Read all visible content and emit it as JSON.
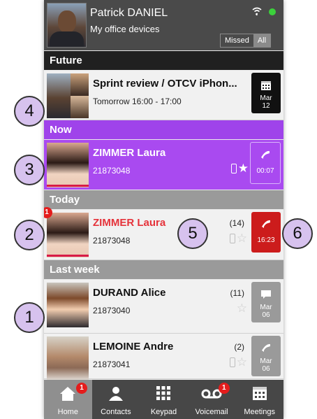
{
  "header": {
    "name": "Patrick DANIEL",
    "subtitle": "My office devices",
    "status_color": "#3bd13b",
    "filter": {
      "missed_label": "Missed",
      "all_label": "All",
      "selected": "All"
    }
  },
  "sections": {
    "future": "Future",
    "now": "Now",
    "today": "Today",
    "last_week": "Last week"
  },
  "rows": {
    "future": {
      "title": "Sprint review / OTCV iPhon...",
      "subtitle": "Tomorrow 16:00 - 17:00",
      "action_icon": "calendar-icon",
      "date_month": "Mar",
      "date_day": "12",
      "action_color": "#111111"
    },
    "now": {
      "name": "ZIMMER Laura",
      "number": "21873048",
      "action_icon": "phone-icon",
      "time": "00:07",
      "accent": "#a94af0"
    },
    "today": {
      "name": "ZIMMER Laura",
      "number": "21873048",
      "count": "(14)",
      "badge": "1",
      "action_icon": "phone-icon",
      "time": "16:23",
      "name_color": "#e5323a",
      "action_color": "#cc1c1c"
    },
    "durand": {
      "name": "DURAND Alice",
      "number": "21873040",
      "count": "(11)",
      "action_icon": "chat-icon",
      "date_month": "Mar",
      "date_day": "06"
    },
    "lemoine": {
      "name": "LEMOINE Andre",
      "number": "21873041",
      "count": "(2)",
      "action_icon": "phone-icon",
      "date_month": "Mar",
      "date_day": "06"
    }
  },
  "tabs": [
    {
      "label": "Home",
      "icon": "home-icon",
      "badge": "1",
      "active": true
    },
    {
      "label": "Contacts",
      "icon": "contact-icon"
    },
    {
      "label": "Keypad",
      "icon": "keypad-icon"
    },
    {
      "label": "Voicemail",
      "icon": "voicemail-icon",
      "badge": "1"
    },
    {
      "label": "Meetings",
      "icon": "meetings-icon"
    }
  ],
  "callouts": [
    "1",
    "2",
    "3",
    "4",
    "5",
    "6"
  ]
}
